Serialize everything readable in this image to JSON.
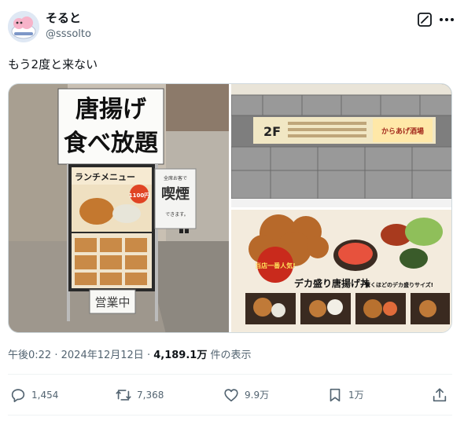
{
  "header": {
    "display_name": "そると",
    "handle": "@sssolto",
    "icons": {
      "grok": "grok-icon",
      "more": "more-icon"
    }
  },
  "tweet": {
    "text": "もう2度と来ない"
  },
  "media": {
    "photos": [
      {
        "name": "street-sign-photo",
        "sign_title_1": "唐揚げ",
        "sign_title_2": "食べ放題",
        "menu_heading": "ランチメニュー",
        "menu_price": "1100円",
        "board_smoking": "喫煙",
        "board_smoking_top": "全席お客で",
        "board_smoking_bottom": "できます。",
        "open_sign": "営業中"
      },
      {
        "name": "stair-sign-photo",
        "floor": "2F",
        "shop": "からあげ酒場"
      },
      {
        "name": "karaage-bowl-poster-photo",
        "badge": "当店一番人気!",
        "title": "デカ盛り唐揚げ丼",
        "subtitle": "驚くほどのデカ盛りサイズ!"
      }
    ]
  },
  "meta": {
    "time": "午後0:22",
    "separator": "·",
    "date": "2024年12月12日",
    "views": "4,189.1万",
    "views_label": "件の表示"
  },
  "actions": {
    "replies": "1,454",
    "reposts": "7,368",
    "likes": "9.9万",
    "bookmarks": "1万"
  },
  "colors": {
    "text": "#0f1419",
    "secondary": "#536471",
    "border": "#eff3f4"
  }
}
